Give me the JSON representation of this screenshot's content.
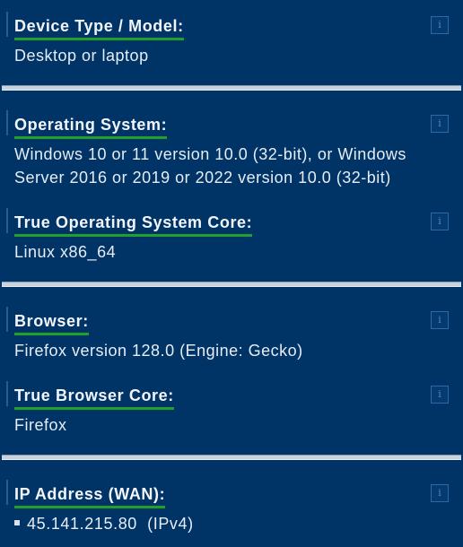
{
  "sections": [
    {
      "label": "Device Type / Model:",
      "value": "Desktop or laptop",
      "info_icon": "info-icon"
    },
    {
      "label": "Operating System:",
      "value": "Windows 10 or 11 version 10.0 (32-bit), or Windows Server 2016 or 2019 or 2022 version 10.0 (32-bit)",
      "info_icon": "info-icon"
    },
    {
      "label": "True Operating System Core:",
      "value": "Linux x86_64",
      "info_icon": "info-icon"
    },
    {
      "label": "Browser:",
      "value": "Firefox version 128.0 (Engine: Gecko)",
      "info_icon": "info-icon"
    },
    {
      "label": "True Browser Core:",
      "value": "Firefox",
      "info_icon": "info-icon"
    },
    {
      "label": "IP Address (WAN):",
      "ip": "45.141.215.80",
      "ip_version": "(IPv4)",
      "info_icon": "info-icon"
    }
  ],
  "info_glyph": "i",
  "colors": {
    "background": "#003366",
    "label_underline": "#22a02c",
    "divider": "#c8d2dc"
  }
}
